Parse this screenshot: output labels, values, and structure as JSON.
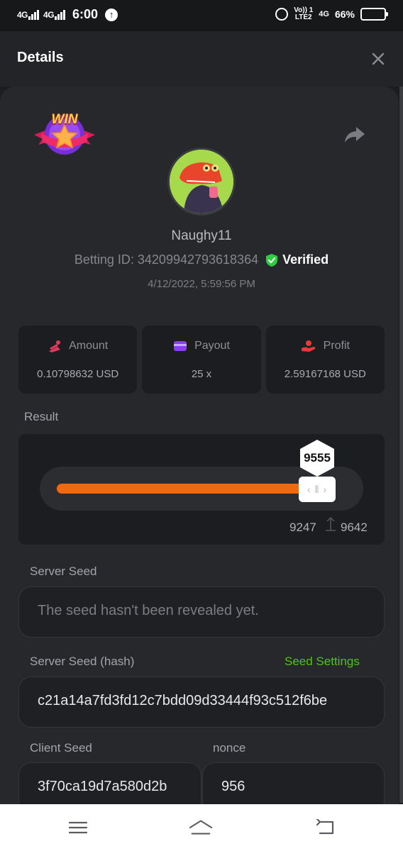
{
  "status_bar": {
    "network1": "4G",
    "network2": "4G",
    "time": "6:00",
    "volte_top": "Vo)) 1",
    "volte_bottom": "LTE2",
    "network3": "4G",
    "battery": "66%",
    "battery_level": 0.66
  },
  "header": {
    "title": "Details"
  },
  "bet": {
    "username": "Naughy11",
    "betting_id_label": "Betting ID: 342099427936183​64",
    "verified": "Verified",
    "datetime": "4/12/2022, 5:59:56 PM",
    "badge": "WIN"
  },
  "stats": [
    {
      "label": "Amount",
      "value": "0.10798632 USD",
      "icon": "coins-icon",
      "color": "#e4385b"
    },
    {
      "label": "Payout",
      "value": "25 x",
      "icon": "wallet-icon",
      "color": "#8b3df0"
    },
    {
      "label": "Profit",
      "value": "2.59167168 USD",
      "icon": "hand-coin-icon",
      "color": "#e83a3a"
    }
  ],
  "result": {
    "label": "Result",
    "value": "9555",
    "range_low": "9247",
    "range_high": "9642",
    "fill_fraction": 0.9
  },
  "server_seed": {
    "label": "Server Seed",
    "placeholder": "The seed hasn't been revealed yet."
  },
  "server_seed_hash": {
    "label": "Server Seed (hash)",
    "link": "Seed Settings",
    "value": "c21a14a7fd3fd12c7bdd09d33444f93c512f6be"
  },
  "client_seed": {
    "label": "Client Seed",
    "value": "3f70ca19d7a580d2b"
  },
  "nonce": {
    "label": "nonce",
    "value": "956"
  },
  "colors": {
    "accent_green": "#4fc414",
    "bar_orange": "#f0690e",
    "verified_green": "#2ecc40"
  }
}
